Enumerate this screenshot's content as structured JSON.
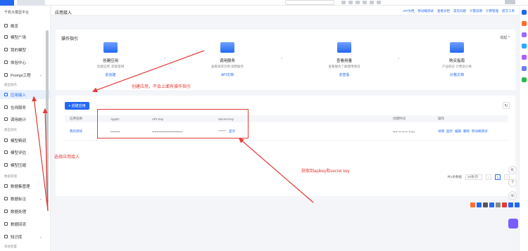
{
  "sidebar": {
    "platform": "千帆大模型平台",
    "items_top": [
      {
        "label": "概览",
        "icon": "overview-icon"
      },
      {
        "label": "模型广场",
        "icon": "model-square-icon"
      },
      {
        "label": "我的模型",
        "icon": "my-model-icon"
      },
      {
        "label": "体验中心",
        "icon": "experience-icon"
      },
      {
        "label": "Prompt工程",
        "icon": "prompt-icon"
      }
    ],
    "group_service": "模型服务",
    "items_service": [
      {
        "label": "应用接入",
        "icon": "app-access-icon"
      },
      {
        "label": "在线服务",
        "icon": "online-service-icon"
      },
      {
        "label": "调用统计",
        "icon": "call-stats-icon"
      }
    ],
    "group_tune": "模型调优",
    "items_tune": [
      {
        "label": "模型精调",
        "icon": "fine-tune-icon"
      },
      {
        "label": "模型评估",
        "icon": "evaluate-icon"
      },
      {
        "label": "模型压缩",
        "icon": "compress-icon"
      }
    ],
    "group_data": "数据管理",
    "items_data": [
      {
        "label": "数据集管理",
        "icon": "dataset-icon"
      },
      {
        "label": "数据标注",
        "icon": "annotation-icon"
      },
      {
        "label": "数据处理",
        "icon": "data-process-icon"
      },
      {
        "label": "数据回流",
        "icon": "data-reflow-icon"
      },
      {
        "label": "知识库",
        "icon": "knowledge-icon"
      }
    ],
    "group_bottom": "系统配置"
  },
  "page": {
    "title": "应用接入",
    "header_links": [
      "API文档",
      "移动端测试",
      "查看文档",
      "常见问题",
      "计量说明",
      "计费管理",
      "提交工单"
    ]
  },
  "guide": {
    "title": "操作指引",
    "collapse": "收起 ^",
    "steps": [
      {
        "name": "创建应用",
        "desc": "创建应用, 获取密钥",
        "link": "去创建"
      },
      {
        "name": "调用服务",
        "desc": "查看请求示例 调用服务",
        "link": "API文档"
      },
      {
        "name": "查看用量",
        "desc": "查看服务了解使用情况",
        "link": "去查看"
      },
      {
        "name": "购买指南",
        "desc": "产品购买 计费及价格",
        "link": "价格文档"
      }
    ]
  },
  "apps": {
    "create_button": "+ 创建应用",
    "columns": [
      "应用名称",
      "AppID",
      "API Key",
      "Secret Key",
      "创建时间",
      "操作"
    ],
    "rows": [
      {
        "name": "我的测试",
        "app_id": "••••••••",
        "api_key": "••••••••••••••••••••••••••",
        "secret_key": "******",
        "show": "显示",
        "created": "•••• •• ••:•• T:43",
        "ops": [
          "详情",
          "监控",
          "编辑",
          "删除",
          "移动端测试"
        ]
      }
    ],
    "pager": {
      "total": "共1条数据",
      "page_size": "10条/页",
      "current": "1"
    }
  },
  "annotations": {
    "note_create": "创建应用，不会上面有操作指引",
    "note_select": "选择应用接入",
    "note_keys": "获取到apikey和secret key"
  },
  "colors": {
    "accent": "#2468f2",
    "annotation": "#e53935",
    "active_bg": "#e8f0fe"
  }
}
